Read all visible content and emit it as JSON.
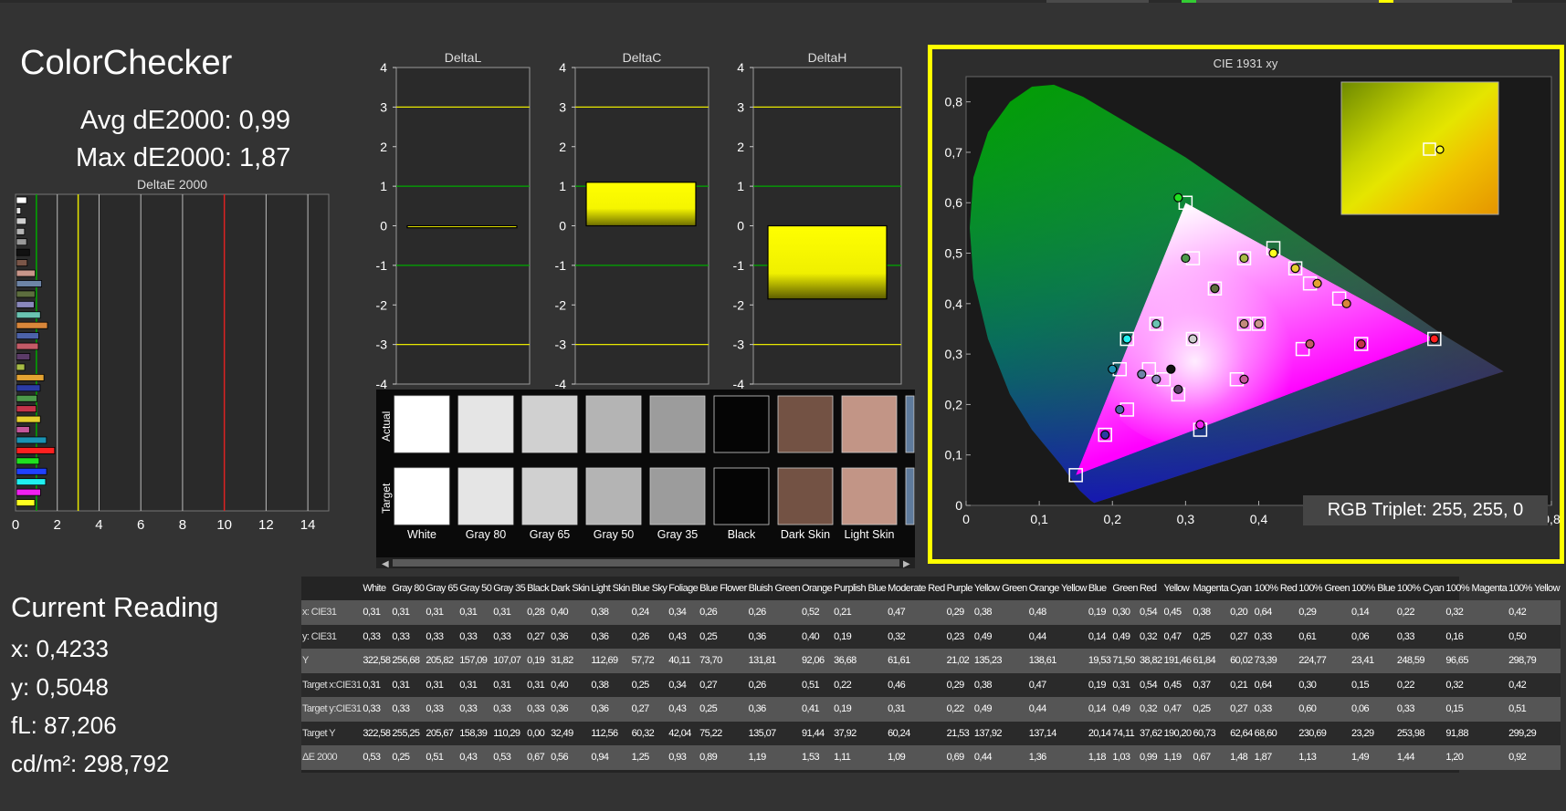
{
  "title": "ColorChecker",
  "avg_de": "Avg dE2000: 0,99",
  "max_de": "Max dE2000: 1,87",
  "current": {
    "title": "Current Reading",
    "x": "x: 0,4233",
    "y": "y: 0,5048",
    "fl": "fL: 87,206",
    "cdm2": "cd/m²: 298,792"
  },
  "rgb_triplet": "RGB Triplet: 255, 255, 0",
  "colors": {
    "accent": "#ffff00",
    "green_line": "#00aa00",
    "red_line": "#dd2222",
    "background": "#333333"
  },
  "chart_data": [
    {
      "type": "bar",
      "title": "DeltaE 2000",
      "orientation": "horizontal",
      "xlim": [
        0,
        15
      ],
      "xticks": [
        "0",
        "2",
        "4",
        "6",
        "8",
        "10",
        "12",
        "14"
      ],
      "reference_lines": [
        1,
        3,
        10
      ],
      "values": [
        0.53,
        0.25,
        0.51,
        0.43,
        0.53,
        0.67,
        0.56,
        0.94,
        1.25,
        0.93,
        0.89,
        1.19,
        1.53,
        1.11,
        1.09,
        0.69,
        0.44,
        1.36,
        1.18,
        1.03,
        0.99,
        1.19,
        0.67,
        1.48,
        1.87,
        1.13,
        1.49,
        1.44,
        1.2,
        0.92
      ],
      "bar_colors": [
        "#ffffff",
        "#e6e6e6",
        "#d0d0d0",
        "#b5b5b5",
        "#9a9a9a",
        "#111111",
        "#7a5648",
        "#c9968a",
        "#6d84a6",
        "#5d6e3e",
        "#8a88bc",
        "#6ac3b2",
        "#d8863a",
        "#4c62a9",
        "#c45a67",
        "#5b3b68",
        "#a7bc45",
        "#e3a332",
        "#2b3ba4",
        "#4c9a4a",
        "#c4344a",
        "#e5cf2e",
        "#c4569b",
        "#1b93b3",
        "#ff2020",
        "#20e020",
        "#2040ff",
        "#20f0f0",
        "#f020f0",
        "#ffff20"
      ]
    },
    {
      "type": "bar",
      "title": "DeltaL",
      "ylim": [
        -4,
        4
      ],
      "yticks": [
        "4",
        "3",
        "2",
        "1",
        "0",
        "-1",
        "-2",
        "-3",
        "-4"
      ],
      "values": [
        -0.05
      ]
    },
    {
      "type": "bar",
      "title": "DeltaC",
      "ylim": [
        -4,
        4
      ],
      "yticks": [
        "4",
        "3",
        "2",
        "1",
        "0",
        "-1",
        "-2",
        "-3",
        "-4"
      ],
      "values": [
        1.1
      ]
    },
    {
      "type": "bar",
      "title": "DeltaH",
      "ylim": [
        -4,
        4
      ],
      "yticks": [
        "4",
        "3",
        "2",
        "1",
        "0",
        "-1",
        "-2",
        "-3",
        "-4"
      ],
      "values": [
        -1.85
      ]
    },
    {
      "type": "scatter",
      "title": "CIE 1931 xy",
      "xlim": [
        0,
        0.8
      ],
      "ylim": [
        0,
        0.85
      ],
      "xticks": [
        "0",
        "0,1",
        "0,2",
        "0,3",
        "0,4",
        "0,5",
        "0,6",
        "0,7",
        "0,8"
      ],
      "yticks": [
        "0",
        "0,1",
        "0,2",
        "0,3",
        "0,4",
        "0,5",
        "0,6",
        "0,7",
        "0,8"
      ],
      "gamut": [
        [
          0.64,
          0.33
        ],
        [
          0.3,
          0.6
        ],
        [
          0.15,
          0.06
        ]
      ],
      "targets": [
        [
          0.31,
          0.33
        ],
        [
          0.4,
          0.36
        ],
        [
          0.38,
          0.36
        ],
        [
          0.25,
          0.27
        ],
        [
          0.34,
          0.43
        ],
        [
          0.27,
          0.25
        ],
        [
          0.26,
          0.36
        ],
        [
          0.51,
          0.41
        ],
        [
          0.22,
          0.19
        ],
        [
          0.46,
          0.31
        ],
        [
          0.29,
          0.22
        ],
        [
          0.38,
          0.49
        ],
        [
          0.47,
          0.44
        ],
        [
          0.19,
          0.14
        ],
        [
          0.31,
          0.49
        ],
        [
          0.54,
          0.32
        ],
        [
          0.45,
          0.47
        ],
        [
          0.37,
          0.25
        ],
        [
          0.21,
          0.27
        ],
        [
          0.64,
          0.33
        ],
        [
          0.3,
          0.6
        ],
        [
          0.15,
          0.06
        ],
        [
          0.22,
          0.33
        ],
        [
          0.32,
          0.15
        ],
        [
          0.42,
          0.51
        ]
      ],
      "actuals": [
        [
          0.31,
          0.33
        ],
        [
          0.4,
          0.36
        ],
        [
          0.38,
          0.36
        ],
        [
          0.24,
          0.26
        ],
        [
          0.34,
          0.43
        ],
        [
          0.26,
          0.25
        ],
        [
          0.26,
          0.36
        ],
        [
          0.52,
          0.4
        ],
        [
          0.21,
          0.19
        ],
        [
          0.47,
          0.32
        ],
        [
          0.29,
          0.23
        ],
        [
          0.38,
          0.49
        ],
        [
          0.48,
          0.44
        ],
        [
          0.19,
          0.14
        ],
        [
          0.3,
          0.49
        ],
        [
          0.54,
          0.32
        ],
        [
          0.45,
          0.47
        ],
        [
          0.38,
          0.25
        ],
        [
          0.2,
          0.27
        ],
        [
          0.64,
          0.33
        ],
        [
          0.29,
          0.61
        ],
        [
          0.28,
          0.27
        ],
        [
          0.22,
          0.33
        ],
        [
          0.32,
          0.16
        ],
        [
          0.42,
          0.5
        ]
      ],
      "point_colors": [
        "#cfcfcf",
        "#c9968a",
        "#c28a7c",
        "#6d84a6",
        "#5d6e3e",
        "#8a88bc",
        "#6ac3b2",
        "#d8863a",
        "#4c62a9",
        "#c45a67",
        "#5b3b68",
        "#a7bc45",
        "#e3a332",
        "#2b3ba4",
        "#4c9a4a",
        "#c4344a",
        "#e5cf2e",
        "#c4569b",
        "#1b93b3",
        "#ff2020",
        "#20e020",
        "#111111",
        "#20f0f0",
        "#f020f0",
        "#ffff20"
      ],
      "inset_target": [
        0.42,
        0.51
      ],
      "inset_actual": [
        0.4233,
        0.5048
      ]
    }
  ],
  "swatches": {
    "row_labels": [
      "Actual",
      "Target"
    ],
    "items": [
      {
        "name": "White",
        "color": "#ffffff"
      },
      {
        "name": "Gray 80",
        "color": "#e5e5e5"
      },
      {
        "name": "Gray 65",
        "color": "#d0d0d0"
      },
      {
        "name": "Gray 50",
        "color": "#b4b4b4"
      },
      {
        "name": "Gray 35",
        "color": "#9c9c9c"
      },
      {
        "name": "Black",
        "color": "#050505"
      },
      {
        "name": "Dark Skin",
        "color": "#735244"
      },
      {
        "name": "Light Skin",
        "color": "#c29586"
      },
      {
        "name": "Blue Sky",
        "color": "#5f7b9c"
      }
    ]
  },
  "table": {
    "headers": [
      "",
      "White",
      "Gray 80",
      "Gray 65",
      "Gray 50",
      "Gray 35",
      "Black",
      "Dark Skin",
      "Light Skin",
      "Blue Sky",
      "Foliage",
      "Blue Flower",
      "Bluish Green",
      "Orange",
      "Purplish Blue",
      "Moderate Red",
      "Purple",
      "Yellow Green",
      "Orange Yellow",
      "Blue",
      "Green",
      "Red",
      "Yellow",
      "Magenta",
      "Cyan",
      "100% Red",
      "100% Green",
      "100% Blue",
      "100% Cyan",
      "100% Magenta",
      "100% Yellow"
    ],
    "rows": [
      [
        "x: CIE31",
        "0,31",
        "0,31",
        "0,31",
        "0,31",
        "0,31",
        "0,28",
        "0,40",
        "0,38",
        "0,24",
        "0,34",
        "0,26",
        "0,26",
        "0,52",
        "0,21",
        "0,47",
        "0,29",
        "0,38",
        "0,48",
        "0,19",
        "0,30",
        "0,54",
        "0,45",
        "0,38",
        "0,20",
        "0,64",
        "0,29",
        "0,14",
        "0,22",
        "0,32",
        "0,42"
      ],
      [
        "y: CIE31",
        "0,33",
        "0,33",
        "0,33",
        "0,33",
        "0,33",
        "0,27",
        "0,36",
        "0,36",
        "0,26",
        "0,43",
        "0,25",
        "0,36",
        "0,40",
        "0,19",
        "0,32",
        "0,23",
        "0,49",
        "0,44",
        "0,14",
        "0,49",
        "0,32",
        "0,47",
        "0,25",
        "0,27",
        "0,33",
        "0,61",
        "0,06",
        "0,33",
        "0,16",
        "0,50"
      ],
      [
        "Y",
        "322,58",
        "256,68",
        "205,82",
        "157,09",
        "107,07",
        "0,19",
        "31,82",
        "112,69",
        "57,72",
        "40,11",
        "73,70",
        "131,81",
        "92,06",
        "36,68",
        "61,61",
        "21,02",
        "135,23",
        "138,61",
        "19,53",
        "71,50",
        "38,82",
        "191,46",
        "61,84",
        "60,02",
        "73,39",
        "224,77",
        "23,41",
        "248,59",
        "96,65",
        "298,79"
      ],
      [
        "Target x:CIE31",
        "0,31",
        "0,31",
        "0,31",
        "0,31",
        "0,31",
        "0,31",
        "0,40",
        "0,38",
        "0,25",
        "0,34",
        "0,27",
        "0,26",
        "0,51",
        "0,22",
        "0,46",
        "0,29",
        "0,38",
        "0,47",
        "0,19",
        "0,31",
        "0,54",
        "0,45",
        "0,37",
        "0,21",
        "0,64",
        "0,30",
        "0,15",
        "0,22",
        "0,32",
        "0,42"
      ],
      [
        "Target y:CIE31",
        "0,33",
        "0,33",
        "0,33",
        "0,33",
        "0,33",
        "0,33",
        "0,36",
        "0,36",
        "0,27",
        "0,43",
        "0,25",
        "0,36",
        "0,41",
        "0,19",
        "0,31",
        "0,22",
        "0,49",
        "0,44",
        "0,14",
        "0,49",
        "0,32",
        "0,47",
        "0,25",
        "0,27",
        "0,33",
        "0,60",
        "0,06",
        "0,33",
        "0,15",
        "0,51"
      ],
      [
        "Target Y",
        "322,58",
        "255,25",
        "205,67",
        "158,39",
        "110,29",
        "0,00",
        "32,49",
        "112,56",
        "60,32",
        "42,04",
        "75,22",
        "135,07",
        "91,44",
        "37,92",
        "60,24",
        "21,53",
        "137,92",
        "137,14",
        "20,14",
        "74,11",
        "37,62",
        "190,20",
        "60,73",
        "62,64",
        "68,60",
        "230,69",
        "23,29",
        "253,98",
        "91,88",
        "299,29"
      ],
      [
        "ΔE 2000",
        "0,53",
        "0,25",
        "0,51",
        "0,43",
        "0,53",
        "0,67",
        "0,56",
        "0,94",
        "1,25",
        "0,93",
        "0,89",
        "1,19",
        "1,53",
        "1,11",
        "1,09",
        "0,69",
        "0,44",
        "1,36",
        "1,18",
        "1,03",
        "0,99",
        "1,19",
        "0,67",
        "1,48",
        "1,87",
        "1,13",
        "1,49",
        "1,44",
        "1,20",
        "0,92"
      ]
    ]
  }
}
